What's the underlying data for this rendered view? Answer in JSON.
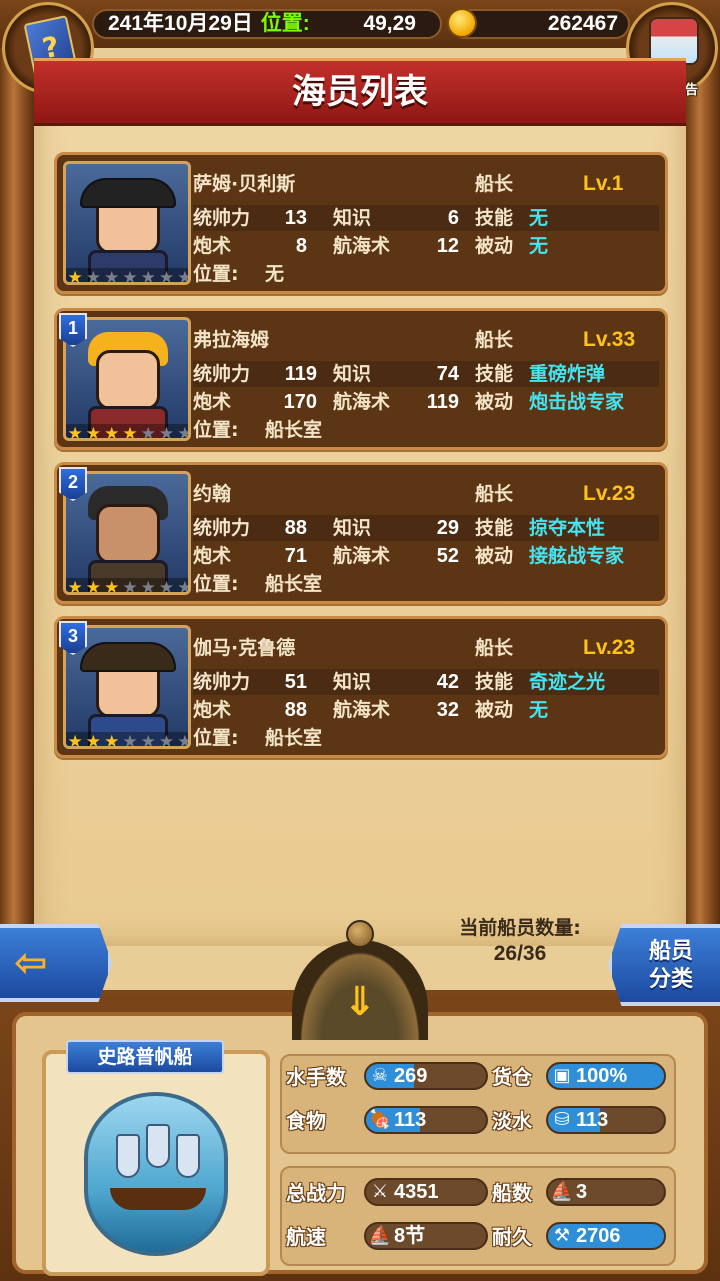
{
  "topbar": {
    "date": "241年10月29日",
    "position_label": "位置:",
    "position_value": "49,29",
    "gold": "262467",
    "ad_label": "暂无广告"
  },
  "title": "海员列表",
  "crew": [
    {
      "name": "萨姆·贝利斯",
      "role": "船长",
      "level": "Lv.1",
      "rank": "",
      "command_label": "统帅力",
      "command": "13",
      "knowledge_label": "知识",
      "knowledge": "6",
      "skill_label": "技能",
      "skill": "无",
      "gunnery_label": "炮术",
      "gunnery": "8",
      "navigation_label": "航海术",
      "navigation": "12",
      "passive_label": "被动",
      "passive": "无",
      "position_label": "位置:",
      "position": "无",
      "stars": 1
    },
    {
      "name": "弗拉海姆",
      "role": "船长",
      "level": "Lv.33",
      "rank": "1",
      "command_label": "统帅力",
      "command": "119",
      "knowledge_label": "知识",
      "knowledge": "74",
      "skill_label": "技能",
      "skill": "重磅炸弹",
      "gunnery_label": "炮术",
      "gunnery": "170",
      "navigation_label": "航海术",
      "navigation": "119",
      "passive_label": "被动",
      "passive": "炮击战专家",
      "position_label": "位置:",
      "position": "船长室",
      "stars": 4
    },
    {
      "name": "约翰",
      "role": "船长",
      "level": "Lv.23",
      "rank": "2",
      "command_label": "统帅力",
      "command": "88",
      "knowledge_label": "知识",
      "knowledge": "29",
      "skill_label": "技能",
      "skill": "掠夺本性",
      "gunnery_label": "炮术",
      "gunnery": "71",
      "navigation_label": "航海术",
      "navigation": "52",
      "passive_label": "被动",
      "passive": "接舷战专家",
      "position_label": "位置:",
      "position": "船长室",
      "stars": 3
    },
    {
      "name": "伽马·克鲁德",
      "role": "船长",
      "level": "Lv.23",
      "rank": "3",
      "command_label": "统帅力",
      "command": "51",
      "knowledge_label": "知识",
      "knowledge": "42",
      "skill_label": "技能",
      "skill": "奇迹之光",
      "gunnery_label": "炮术",
      "gunnery": "88",
      "navigation_label": "航海术",
      "navigation": "32",
      "passive_label": "被动",
      "passive": "无",
      "position_label": "位置:",
      "position": "船长室",
      "stars": 3
    }
  ],
  "crew_count": {
    "label": "当前船员数量:",
    "value": "26/36"
  },
  "sort_button": {
    "line1": "船员",
    "line2": "分类"
  },
  "ship": {
    "name": "史路普帆船",
    "sailors_label": "水手数",
    "sailors": "269",
    "cargo_label": "货仓",
    "cargo": "100%",
    "food_label": "食物",
    "food": "113",
    "water_label": "淡水",
    "water": "113",
    "power_label": "总战力",
    "power": "4351",
    "ships_label": "船数",
    "ships": "3",
    "speed_label": "航速",
    "speed": "8节",
    "durability_label": "耐久",
    "durability": "2706"
  },
  "colors": {
    "skill_text": "#44e4f0",
    "level_text": "#ffc21a",
    "banner": "#c2302b"
  },
  "icons": [
    "book-icon",
    "gold-coin-icon",
    "treasure-chest-icon",
    "back-arrow-icon",
    "collapse-chevron-icon",
    "star-icon"
  ]
}
